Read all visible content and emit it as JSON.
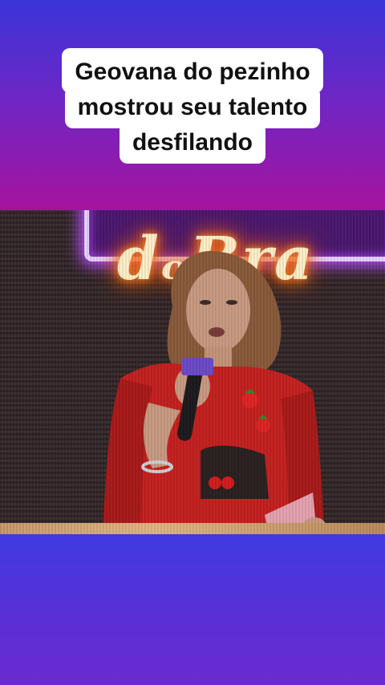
{
  "caption": {
    "line1": "Geovana do pezinho",
    "line2": "mostrou seu talento",
    "line3": "desfilando"
  },
  "colors": {
    "bg_top": "#3a34d8",
    "bg_mid": "#a6139e",
    "bg_bottom": "#4a38dc",
    "caption_bg": "#ffffff",
    "caption_text": "#111111"
  }
}
